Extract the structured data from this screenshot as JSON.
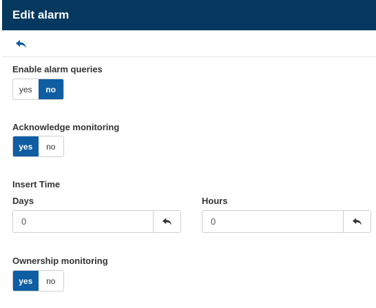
{
  "dialog": {
    "title": "Edit alarm"
  },
  "toolbar": {
    "back_icon": "undo-arrow-icon"
  },
  "enable_alarm_queries": {
    "label": "Enable alarm queries",
    "yes": "yes",
    "no": "no",
    "selected": "no"
  },
  "acknowledge_monitoring": {
    "label": "Acknowledge monitoring",
    "yes": "yes",
    "no": "no",
    "selected": "yes"
  },
  "insert_time": {
    "label": "Insert Time",
    "days": {
      "label": "Days",
      "value": "0",
      "reset_icon": "undo-arrow-icon"
    },
    "hours": {
      "label": "Hours",
      "value": "0",
      "reset_icon": "undo-arrow-icon"
    }
  },
  "ownership_monitoring": {
    "label": "Ownership monitoring",
    "yes": "yes",
    "no": "no",
    "selected": "yes"
  },
  "colors": {
    "header": "#04385f",
    "accent": "#0f5da3"
  }
}
